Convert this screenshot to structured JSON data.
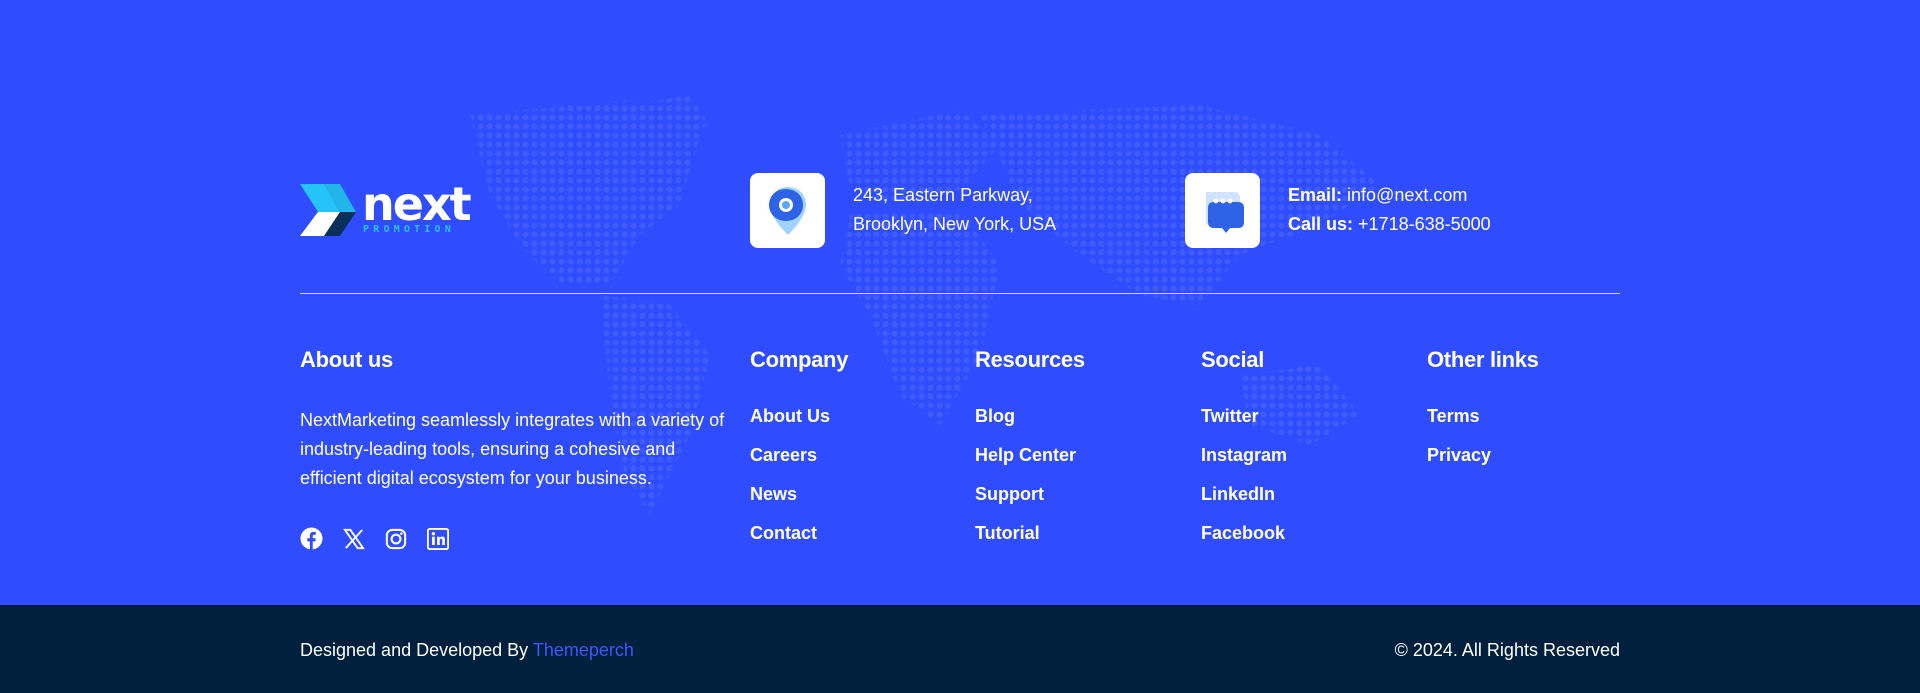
{
  "brand": {
    "logo_word": "next",
    "logo_tagline": "PROMOTION",
    "colors": {
      "primary": "#2f4dff",
      "dark": "#01203d",
      "accent": "#25c3f7",
      "link": "#3c57ff"
    }
  },
  "contact": {
    "address_icon": "location-pin-icon",
    "address_line1": "243, Eastern Parkway,",
    "address_line2": "Brooklyn, New York, USA",
    "chat_icon": "chat-bubble-icon",
    "email_label": "Email:",
    "email_value": "info@next.com",
    "phone_label": "Call us:",
    "phone_value": "+1718-638-5000"
  },
  "about": {
    "title": "About us",
    "text": "NextMarketing seamlessly integrates with a variety of industry-leading tools, ensuring a cohesive and efficient digital ecosystem for your business.",
    "social_icons": [
      "facebook-icon",
      "x-twitter-icon",
      "instagram-icon",
      "linkedin-icon"
    ]
  },
  "columns": [
    {
      "title": "Company",
      "links": [
        "About Us",
        "Careers",
        "News",
        "Contact"
      ]
    },
    {
      "title": "Resources",
      "links": [
        "Blog",
        "Help Center",
        "Support",
        "Tutorial"
      ]
    },
    {
      "title": "Social",
      "links": [
        "Twitter",
        "Instagram",
        "LinkedIn",
        "Facebook"
      ]
    },
    {
      "title": "Other links",
      "links": [
        "Terms",
        "Privacy"
      ]
    }
  ],
  "bottom": {
    "credit_prefix": "Designed and Developed By",
    "credit_link": "Themeperch",
    "copyright": "© 2024. All Rights Reserved"
  }
}
